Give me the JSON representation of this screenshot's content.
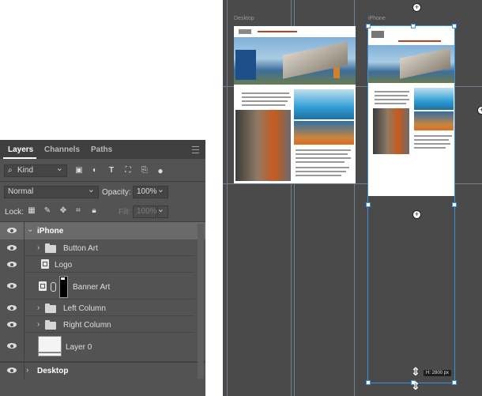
{
  "layers_panel": {
    "tabs": [
      {
        "label": "Layers",
        "active": true
      },
      {
        "label": "Channels",
        "active": false
      },
      {
        "label": "Paths",
        "active": false
      }
    ],
    "filter": {
      "kind_label": "Kind"
    },
    "blend_mode": "Normal",
    "opacity_label": "Opacity:",
    "opacity_value": "100%",
    "lock_label": "Lock:",
    "fill_label": "Fill:",
    "fill_value": "100%",
    "layers": [
      {
        "name": "iPhone",
        "type": "group",
        "expanded": true,
        "selected": true,
        "visible": true
      },
      {
        "name": "Button Art",
        "type": "group",
        "expanded": false,
        "visible": true
      },
      {
        "name": "Logo",
        "type": "smart-object",
        "visible": true
      },
      {
        "name": "Banner Art",
        "type": "smart-object-masked",
        "visible": true
      },
      {
        "name": "Left Column",
        "type": "group",
        "expanded": false,
        "visible": true
      },
      {
        "name": "Right Column",
        "type": "group",
        "expanded": false,
        "visible": true
      },
      {
        "name": "Layer 0",
        "type": "pixel",
        "visible": true
      },
      {
        "name": "Desktop",
        "type": "group",
        "expanded": false,
        "visible": true
      }
    ]
  },
  "canvas": {
    "artboards": [
      {
        "label": "Desktop"
      },
      {
        "label": "iPhone"
      }
    ],
    "resize_tooltip": "H: 2800 px",
    "colors": {
      "selection": "#3a8ee0",
      "canvas_bg": "#4a4a4a",
      "panel_bg": "#535353"
    }
  }
}
